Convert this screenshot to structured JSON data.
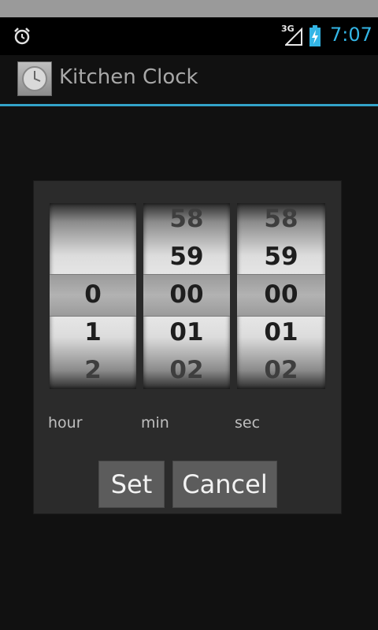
{
  "status_bar": {
    "network": "3G",
    "time": "7:07",
    "icons": [
      "alarm-icon",
      "signal-icon",
      "battery-charging-icon"
    ]
  },
  "action_bar": {
    "title": "Kitchen Clock",
    "icon": "clock-app-icon"
  },
  "picker": {
    "hour": {
      "label": "hour",
      "values": [
        "",
        "",
        "0",
        "1",
        "2"
      ],
      "selected": "0"
    },
    "min": {
      "label": "min",
      "values": [
        "58",
        "59",
        "00",
        "01",
        "02"
      ],
      "selected": "00"
    },
    "sec": {
      "label": "sec",
      "values": [
        "58",
        "59",
        "00",
        "01",
        "02"
      ],
      "selected": "00"
    }
  },
  "buttons": {
    "set": "Set",
    "cancel": "Cancel"
  },
  "colors": {
    "accent": "#33b5e5",
    "divider": "#33a3c9",
    "background": "#111111"
  }
}
